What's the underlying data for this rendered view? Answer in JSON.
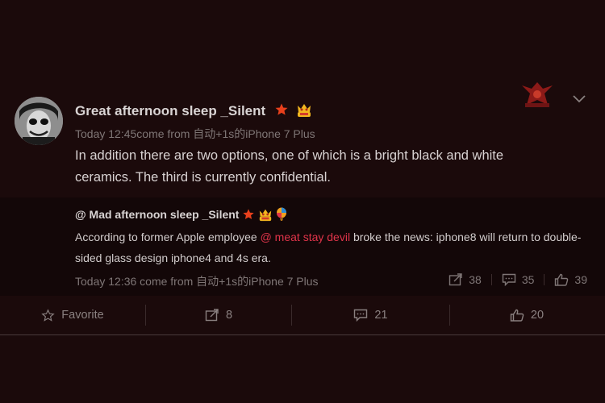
{
  "post": {
    "user_name": "Great afternoon sleep _Silent",
    "meta": "Today 12:45come from 自动+1s的iPhone 7 Plus",
    "text": "In addition there are two options, one of which is a bright black and white ceramics. The third is currently confidential."
  },
  "repost": {
    "user_name": "@ Mad afternoon sleep _Silent",
    "text_before": "According to former Apple employee ",
    "mention": "@ meat stay devil",
    "text_after": " broke the news: iphone8 will return to double-sided glass design iphone4 and 4s era.",
    "meta": "Today 12:36 come from 自动+1s的iPhone 7 Plus",
    "stats": {
      "reposts": "38",
      "comments": "35",
      "likes": "39"
    }
  },
  "actions": {
    "favorite": "Favorite",
    "repost": "8",
    "comment": "21",
    "like": "20"
  },
  "icons": {
    "badge_star": "star-icon",
    "badge_vip": "vip-icon",
    "badge_balloon": "balloon-icon",
    "menu": "chevron-down-icon"
  },
  "colors": {
    "background": "#1b0a0b",
    "repost_background": "#130708",
    "mention": "#e0344a",
    "badge_star": "#e8401c"
  }
}
